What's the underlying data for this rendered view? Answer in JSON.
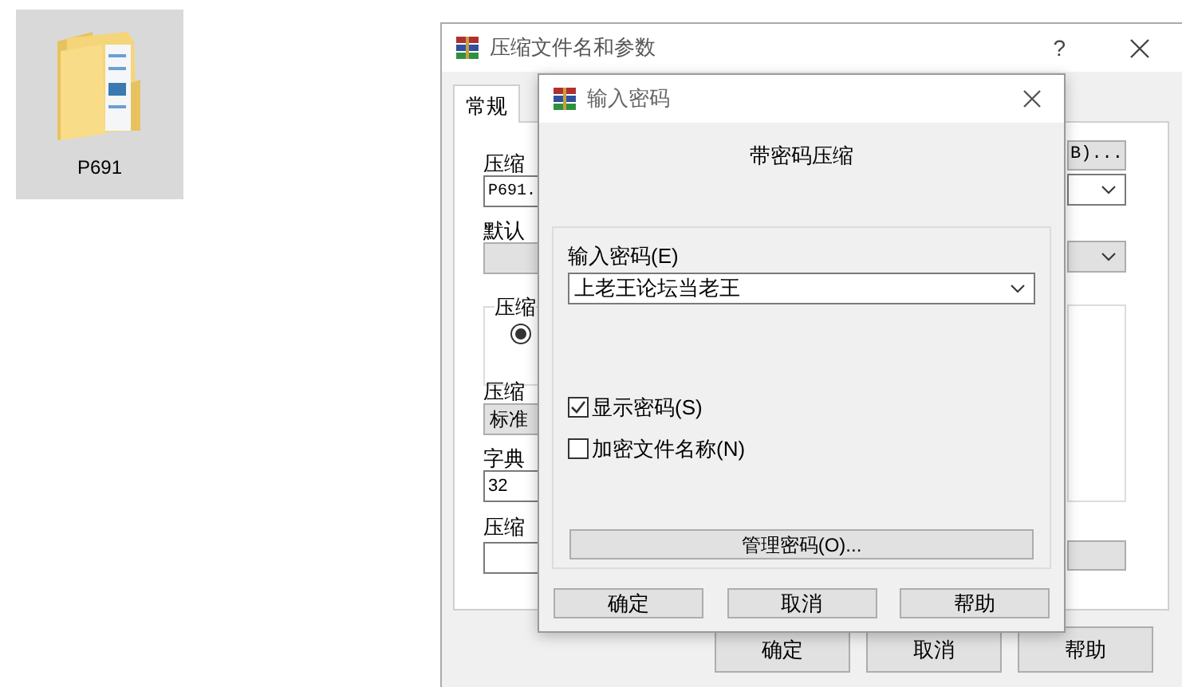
{
  "desktop_icon": {
    "label": "P691",
    "selected": true
  },
  "back_dialog": {
    "title": "压缩文件名和参数",
    "help": "?",
    "tabs": [
      {
        "label": "常规",
        "selected": true
      }
    ],
    "left_labels": [
      "压缩",
      "默认",
      "压缩",
      "字典",
      "压缩"
    ],
    "archive_name": "P691.",
    "group_label": "压缩",
    "radio_checked": true,
    "method": "标准",
    "dictionary": "32",
    "browse_button": "B)...",
    "buttons": [
      "确定",
      "取消",
      "帮助"
    ]
  },
  "password_dialog": {
    "title": "输入密码",
    "heading": "带密码压缩",
    "password_label": "输入密码(E)",
    "password": "上老王论坛当老王",
    "options": [
      {
        "label": "显示密码(S)",
        "checked": true
      },
      {
        "label": "加密文件名称(N)",
        "checked": false
      }
    ],
    "manage_button": "管理密码(O)...",
    "buttons": [
      "确定",
      "取消",
      "帮助"
    ]
  }
}
